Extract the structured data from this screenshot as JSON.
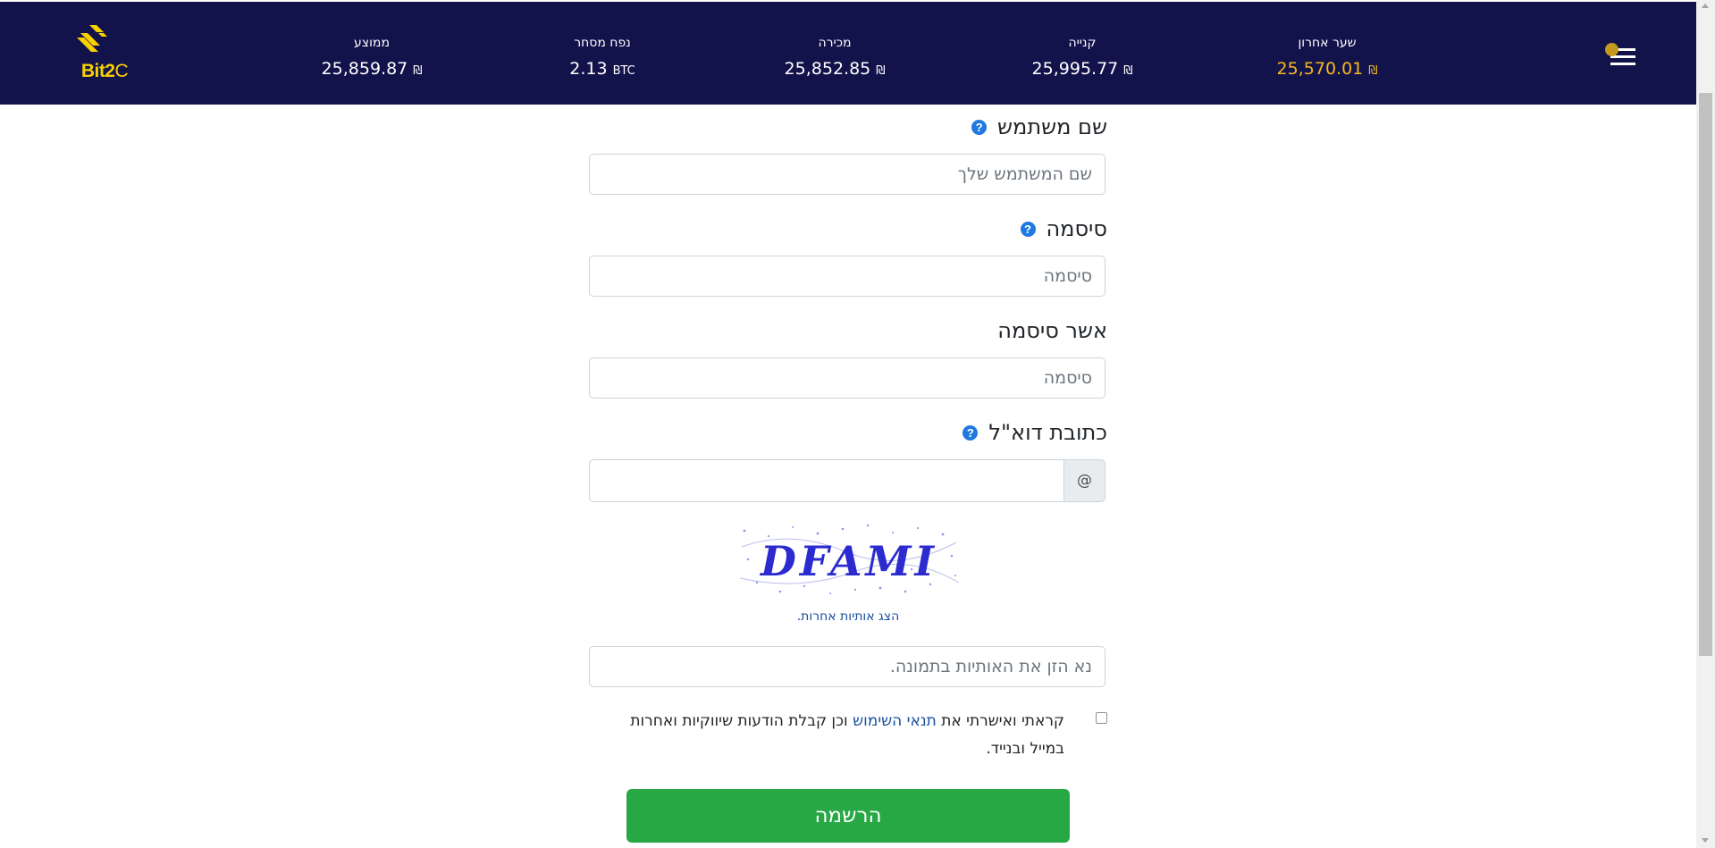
{
  "brand": {
    "logo_text": "Bit2",
    "logo_text_c": "C",
    "color": "#f7d000"
  },
  "ticker": [
    {
      "label": "שער אחרון",
      "value": "25,570.01",
      "currency": "₪",
      "highlight": true
    },
    {
      "label": "קנייה",
      "value": "25,995.77",
      "currency": "₪"
    },
    {
      "label": "מכירה",
      "value": "25,852.85",
      "currency": "₪"
    },
    {
      "label": "נפח מסחר",
      "value": "2.13",
      "currency": "BTC"
    },
    {
      "label": "ממוצע",
      "value": "25,859.87",
      "currency": "₪"
    }
  ],
  "form": {
    "username": {
      "label": "שם משתמש",
      "placeholder": "שם המשתמש שלך",
      "help": "?"
    },
    "password": {
      "label": "סיסמה",
      "placeholder": "סיסמה",
      "help": "?"
    },
    "confirm_password": {
      "label": "אשר סיסמה",
      "placeholder": "סיסמה"
    },
    "email": {
      "label": "כתובת דוא\"ל",
      "addon": "@",
      "value": "",
      "help": "?"
    },
    "captcha": {
      "text": "DFAMI",
      "refresh_label": "הצג אותיות אחרות.",
      "placeholder": "נא הזן את האותיות בתמונה."
    },
    "terms": {
      "prefix": "קראתי ואישרתי את",
      "link": "תנאי השימוש",
      "suffix": "וכן קבלת הודעות שיווקיות ואחרות במייל ובנייד.",
      "checked": false
    },
    "submit_label": "הרשמה"
  },
  "colors": {
    "header_bg": "#13134c",
    "highlight": "#f5b81c",
    "submit": "#28a745",
    "help": "#1f7ae0"
  }
}
